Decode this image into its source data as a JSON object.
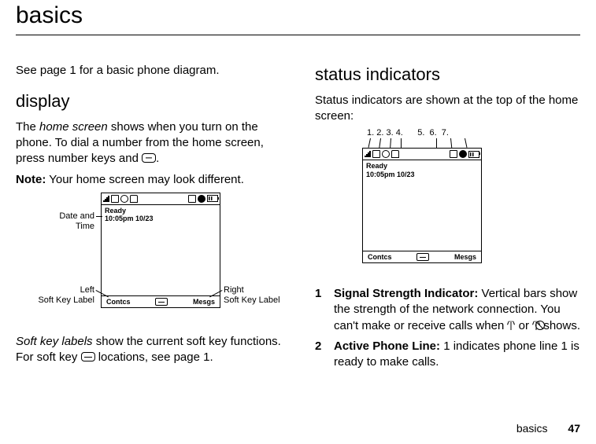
{
  "page": {
    "title": "basics",
    "footer_label": "basics",
    "page_number": "47"
  },
  "left": {
    "intro": "See page 1 for a basic phone diagram.",
    "h_display": "display",
    "p1_a": "The ",
    "p1_b_ital": "home screen",
    "p1_c": " shows when you turn on the phone. To dial a number from the home screen, press number keys and ",
    "p1_d": ".",
    "note_label": "Note:",
    "note_rest": " Your home screen may look different.",
    "fig": {
      "ready": "Ready",
      "datetime": "10:05pm 10/23",
      "left_soft": "Contcs",
      "right_soft": "Mesgs",
      "annot_datetime_l1": "Date and",
      "annot_datetime_l2": "Time",
      "annot_left_l1": "Left",
      "annot_left_l2": "Soft Key Label",
      "annot_right_l1": "Right",
      "annot_right_l2": "Soft Key Label"
    },
    "p2_a_ital": "Soft key labels",
    "p2_b": " show the current soft key functions. For soft key ",
    "p2_c": " locations, see page 1."
  },
  "right": {
    "h_status": "status indicators",
    "p1": "Status indicators are shown at the top of the home screen:",
    "fig": {
      "ready": "Ready",
      "datetime": "10:05pm 10/23",
      "left_soft": "Contcs",
      "right_soft": "Mesgs",
      "nums": "1. 2. 3. 4.      5.  6.  7."
    },
    "item1_num": "1",
    "item1_label": "Signal Strength Indicator:",
    "item1_rest_a": " Vertical bars show the strength of the network connection. You can't make or receive calls when ",
    "item1_rest_b": " or ",
    "item1_rest_c": " shows.",
    "item2_num": "2",
    "item2_label": "Active Phone Line:",
    "item2_rest": " 1 indicates phone line 1 is ready to make calls."
  }
}
